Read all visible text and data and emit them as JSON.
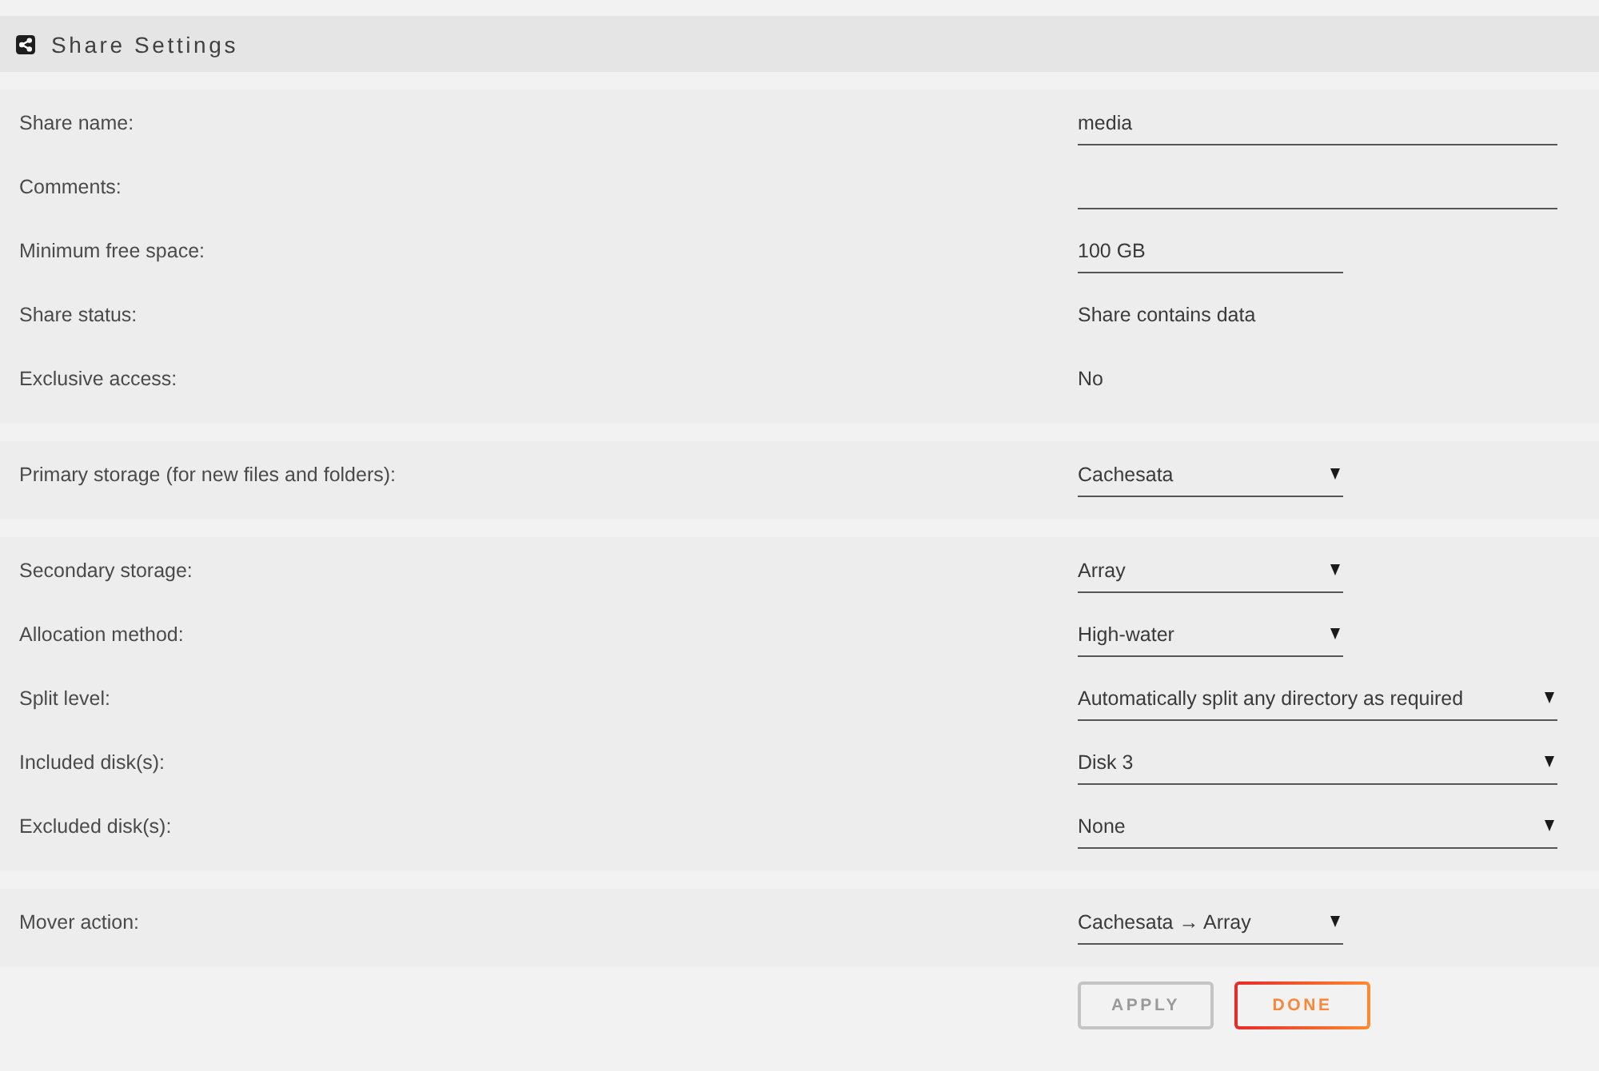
{
  "panel": {
    "title": "Share Settings"
  },
  "sections": [
    {
      "rows": [
        {
          "label": "Share name:",
          "kind": "field",
          "value": "media"
        },
        {
          "label": "Comments:",
          "kind": "field"
        },
        {
          "label": "Minimum free space:",
          "kind": "short-field",
          "value": "100 GB"
        },
        {
          "label": "Share status:",
          "kind": "text",
          "value": "Share contains data"
        },
        {
          "label": "Exclusive access:",
          "kind": "text",
          "value": "No"
        }
      ]
    },
    {
      "rows": [
        {
          "label": "Primary storage (for new files and folders):",
          "kind": "short-dropdown",
          "value": "Cachesata"
        }
      ]
    },
    {
      "rows": [
        {
          "label": "Secondary storage:",
          "kind": "short-dropdown",
          "value": "Array"
        },
        {
          "label": "Allocation method:",
          "kind": "short-dropdown",
          "value": "High-water"
        },
        {
          "label": "Split level:",
          "kind": "dropdown",
          "value": "Automatically split any directory as required"
        },
        {
          "label": "Included disk(s):",
          "kind": "dropdown",
          "value": "Disk 3"
        },
        {
          "label": "Excluded disk(s):",
          "kind": "dropdown",
          "value": "None"
        }
      ]
    },
    {
      "rows": [
        {
          "label": "Mover action:",
          "kind": "short-dropdown",
          "value": "Cachesata → Array"
        }
      ]
    }
  ],
  "buttons": [
    {
      "label": "APPLY",
      "disabled": true
    },
    {
      "label": "DONE",
      "disabled": false
    }
  ]
}
